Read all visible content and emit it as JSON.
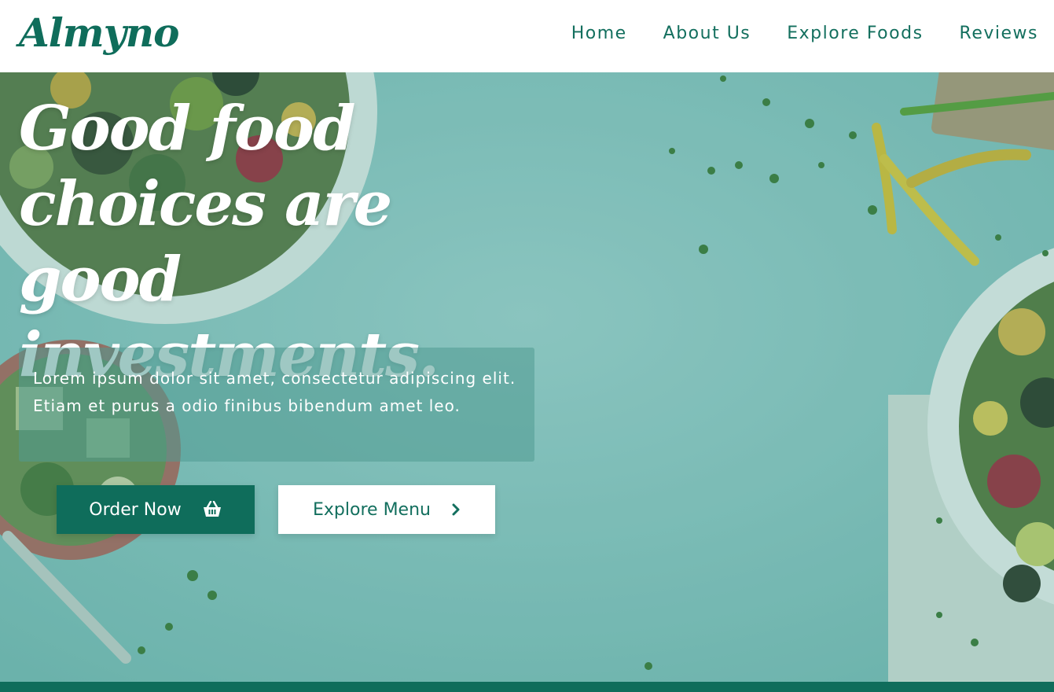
{
  "brand": {
    "logo": "Almyno",
    "accent_color": "#0f6d5b"
  },
  "nav": {
    "items": [
      {
        "label": "Home"
      },
      {
        "label": "About Us"
      },
      {
        "label": "Explore Foods"
      },
      {
        "label": "Reviews"
      }
    ]
  },
  "hero": {
    "headline": "Good food choices are good investments.",
    "intro": "Lorem ipsum dolor sit amet, consectetur adipiscing elit. Etiam et purus a odio finibus bibendum amet leo.",
    "buttons": {
      "order_label": "Order Now",
      "order_icon": "shopping-basket-icon",
      "explore_label": "Explore Menu",
      "explore_icon": "chevron-right-icon"
    },
    "background": "teal tabletop with salad bowls, peppers and herbs"
  }
}
